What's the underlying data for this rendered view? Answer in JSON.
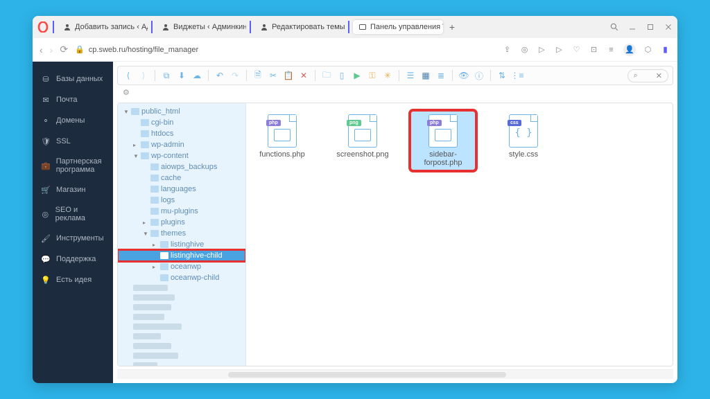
{
  "tabs": [
    {
      "label": "Добавить запись ‹ Админ"
    },
    {
      "label": "Виджеты ‹ Админкин —"
    },
    {
      "label": "Редактировать темы ‹ Ад"
    },
    {
      "label": "Панель управления VH",
      "active": true
    }
  ],
  "url": "cp.sweb.ru/hosting/file_manager",
  "sidebar": [
    {
      "icon": "db",
      "label": "Базы данных"
    },
    {
      "icon": "mail",
      "label": "Почта"
    },
    {
      "icon": "domain",
      "label": "Домены"
    },
    {
      "icon": "ssl",
      "label": "SSL"
    },
    {
      "icon": "partner",
      "label": "Партнерская программа"
    },
    {
      "icon": "shop",
      "label": "Магазин"
    },
    {
      "icon": "seo",
      "label": "SEO и реклама"
    },
    {
      "icon": "tools",
      "label": "Инструменты"
    },
    {
      "icon": "support",
      "label": "Поддержка"
    },
    {
      "icon": "idea",
      "label": "Есть идея"
    }
  ],
  "tree": [
    {
      "d": 0,
      "exp": "▼",
      "label": "public_html",
      "open": true
    },
    {
      "d": 1,
      "exp": "",
      "label": "cgi-bin"
    },
    {
      "d": 1,
      "exp": "",
      "label": "htdocs"
    },
    {
      "d": 1,
      "exp": "▸",
      "label": "wp-admin"
    },
    {
      "d": 1,
      "exp": "▼",
      "label": "wp-content",
      "open": true
    },
    {
      "d": 2,
      "exp": "",
      "label": "aiowps_backups"
    },
    {
      "d": 2,
      "exp": "",
      "label": "cache"
    },
    {
      "d": 2,
      "exp": "",
      "label": "languages"
    },
    {
      "d": 2,
      "exp": "",
      "label": "logs"
    },
    {
      "d": 2,
      "exp": "",
      "label": "mu-plugins"
    },
    {
      "d": 2,
      "exp": "▸",
      "label": "plugins"
    },
    {
      "d": 2,
      "exp": "▼",
      "label": "themes",
      "open": true
    },
    {
      "d": 3,
      "exp": "▸",
      "label": "listinghive"
    },
    {
      "d": 3,
      "exp": "",
      "label": "listinghive-child",
      "selected": true,
      "highlight": true
    },
    {
      "d": 3,
      "exp": "▸",
      "label": "oceanwp"
    },
    {
      "d": 3,
      "exp": "",
      "label": "oceanwp-child"
    }
  ],
  "files": [
    {
      "name": "functions.php",
      "type": "php"
    },
    {
      "name": "screenshot.png",
      "type": "png"
    },
    {
      "name": "sidebar-forpost.php",
      "type": "php",
      "selected": true,
      "highlight": true
    },
    {
      "name": "style.css",
      "type": "css"
    }
  ],
  "search_placeholder": "⌕"
}
